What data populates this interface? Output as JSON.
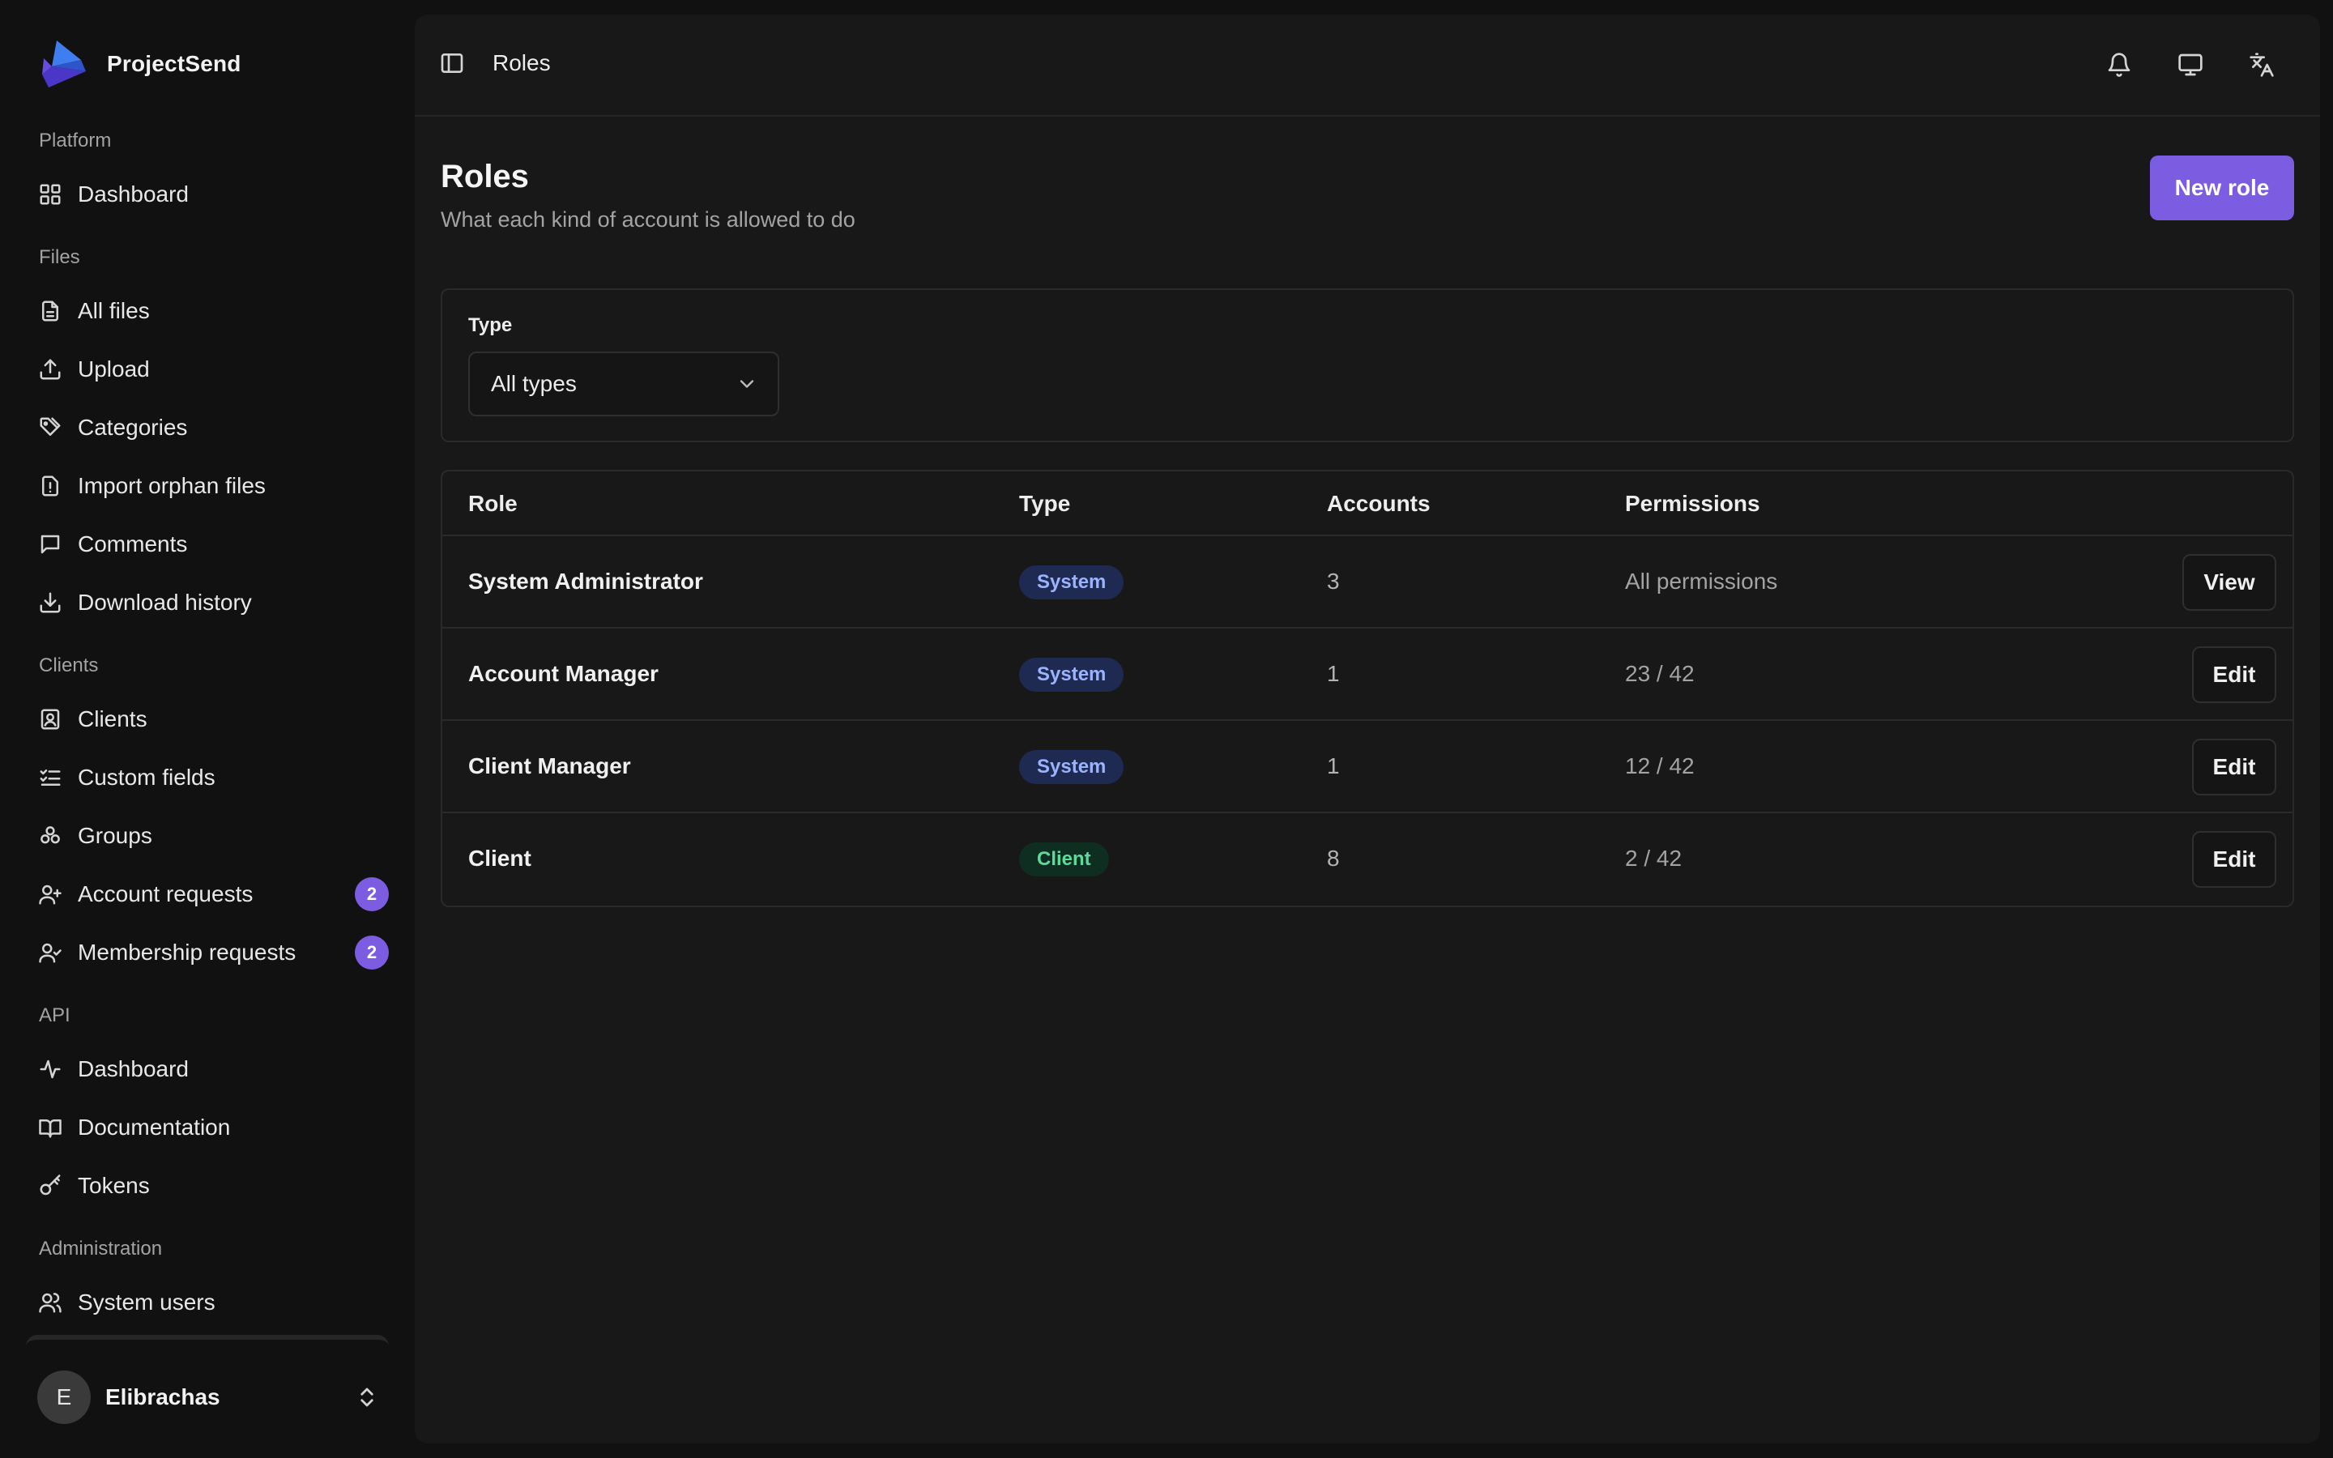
{
  "brand": {
    "name": "ProjectSend"
  },
  "sidebar": {
    "sections": [
      {
        "label": "Platform"
      },
      {
        "label": "Files"
      },
      {
        "label": "Clients"
      },
      {
        "label": "API"
      },
      {
        "label": "Administration"
      }
    ],
    "items": [
      {
        "label": "Dashboard",
        "icon": "grid-icon"
      },
      {
        "label": "All files",
        "icon": "file-icon"
      },
      {
        "label": "Upload",
        "icon": "upload-icon"
      },
      {
        "label": "Categories",
        "icon": "tags-icon"
      },
      {
        "label": "Import orphan files",
        "icon": "file-alert-icon"
      },
      {
        "label": "Comments",
        "icon": "comment-icon"
      },
      {
        "label": "Download history",
        "icon": "download-icon"
      },
      {
        "label": "Clients",
        "icon": "contact-icon"
      },
      {
        "label": "Custom fields",
        "icon": "list-check-icon"
      },
      {
        "label": "Groups",
        "icon": "groups-icon"
      },
      {
        "label": "Account requests",
        "icon": "user-plus-icon",
        "badge": "2"
      },
      {
        "label": "Membership requests",
        "icon": "user-check-icon",
        "badge": "2"
      },
      {
        "label": "Dashboard",
        "icon": "activity-icon"
      },
      {
        "label": "Documentation",
        "icon": "book-icon"
      },
      {
        "label": "Tokens",
        "icon": "key-icon"
      },
      {
        "label": "System users",
        "icon": "users-icon"
      }
    ]
  },
  "user": {
    "initial": "E",
    "name": "Elibrachas"
  },
  "topbar": {
    "breadcrumb": "Roles",
    "icons": [
      "bell-icon",
      "monitor-icon",
      "translate-icon"
    ]
  },
  "page": {
    "title": "Roles",
    "subtitle": "What each kind of account is allowed to do",
    "new_button": "New role"
  },
  "filter": {
    "label": "Type",
    "selected": "All types"
  },
  "table": {
    "headers": {
      "role": "Role",
      "type": "Type",
      "accounts": "Accounts",
      "permissions": "Permissions"
    },
    "rows": [
      {
        "role": "System Administrator",
        "type": "System",
        "accounts": "3",
        "permissions": "All permissions",
        "action": "View"
      },
      {
        "role": "Account Manager",
        "type": "System",
        "accounts": "1",
        "permissions": "23 / 42",
        "action": "Edit"
      },
      {
        "role": "Client Manager",
        "type": "System",
        "accounts": "1",
        "permissions": "12 / 42",
        "action": "Edit"
      },
      {
        "role": "Client",
        "type": "Client",
        "accounts": "8",
        "permissions": "2 / 42",
        "action": "Edit"
      }
    ]
  },
  "colors": {
    "accent": "#7c5ce0",
    "system_badge_bg": "#1f2a52",
    "system_badge_text": "#9bb3ff",
    "client_badge_bg": "#0f2e22",
    "client_badge_text": "#5ddb9a"
  }
}
